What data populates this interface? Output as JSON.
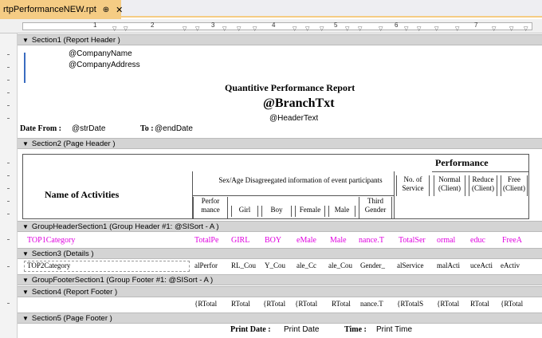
{
  "tab": {
    "title": "rtpPerformanceNEW.rpt",
    "pin": "⊕",
    "close": "✕"
  },
  "ruler": {
    "numbers": [
      "1",
      "2",
      "3",
      "4",
      "5",
      "6",
      "7"
    ]
  },
  "sections": {
    "s1": "Section1 (Report Header )",
    "s2": "Section2 (Page Header )",
    "gh1": "GroupHeaderSection1 (Group Header #1: @SISort - A )",
    "s3": "Section3 (Details )",
    "gf1": "GroupFooterSection1 (Group Footer #1: @SISort - A )",
    "s4": "Section4 (Report Footer )",
    "s5": "Section5 (Page Footer )"
  },
  "report_header": {
    "company_name": "@CompanyName",
    "company_address": "@CompanyAddress",
    "title": "Quantitive Performance Report",
    "branch": "@BranchTxt",
    "header_text": "@HeaderText",
    "date_from_label": "Date From :",
    "str_date": "@strDate",
    "to_label": "To :",
    "end_date": "@endDate"
  },
  "page_header": {
    "performance": "Performance",
    "name_of_activities": "Name of Activities",
    "sex_age": "Sex/Age Disagreegated information of event participants",
    "cols": [
      "Perfor mance",
      "Girl",
      "Boy",
      "Female",
      "Male",
      "Third Gender"
    ],
    "no_of_service": "No. of Service",
    "normal": "Normal (Client)",
    "reduce": "Reduce (Client)",
    "free": "Free (Client)"
  },
  "group_header": [
    "TOP1Category",
    "TotalPe",
    "GIRL",
    "BOY",
    "eMale",
    "Male",
    "nance.T",
    "TotalSer",
    "ormal",
    "educ",
    "FreeA"
  ],
  "details": [
    "TOP2Category",
    "alPerfor",
    "RL_Cou",
    "Y_Cou",
    "ale_Cc",
    "ale_Cou",
    "Gender_",
    "alService",
    "malActi",
    "uceActi",
    "eActiv"
  ],
  "report_footer": [
    "{RTotal",
    "RTotal",
    "{RTotal",
    "{RTotal",
    "RTotal",
    "nance.T",
    "{RTotalS",
    "{RTotal",
    "RTotal",
    "{RTotal"
  ],
  "page_footer": {
    "print_date_label": "Print Date :",
    "print_date": "Print Date",
    "time_label": "Time :",
    "print_time": "Print Time"
  },
  "colors": {
    "tab": "#f5cc84",
    "section": "#d4d4d4",
    "group_field": "#e000e0"
  }
}
